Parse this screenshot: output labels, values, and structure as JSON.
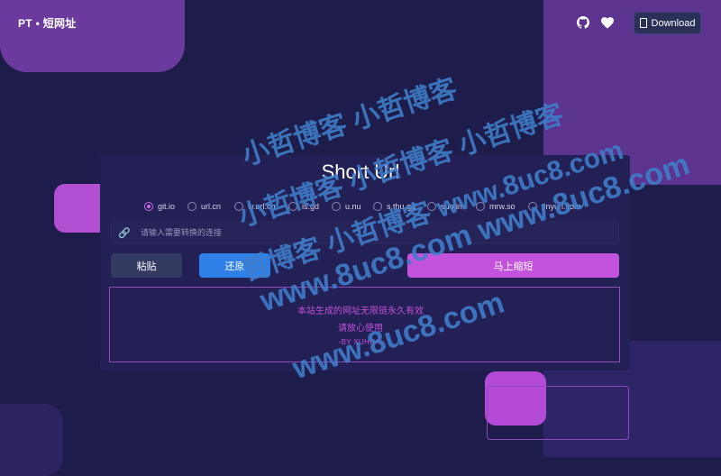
{
  "header": {
    "brand": "PT • 短网址",
    "download_label": "Download",
    "icons": {
      "github": "github-icon",
      "heart": "heart-icon"
    }
  },
  "main": {
    "title": "Short Url",
    "services": [
      {
        "label": "git.io",
        "selected": true
      },
      {
        "label": "url.cn",
        "selected": false
      },
      {
        "label": "w.url.cn",
        "selected": false
      },
      {
        "label": "is.gd",
        "selected": false
      },
      {
        "label": "u.nu",
        "selected": false
      },
      {
        "label": "s.thu.gg",
        "selected": false
      },
      {
        "label": "suo.im",
        "selected": false
      },
      {
        "label": "mrw.so",
        "selected": false
      },
      {
        "label": "tinyurl.com",
        "selected": false
      }
    ],
    "url_placeholder": "请输入需要转换的连接",
    "paste_label": "粘贴",
    "restore_label": "还原",
    "shorten_label": "马上缩短",
    "result": {
      "line1": "本站生成的网址无限链永久有效",
      "line2": "请放心使用",
      "line3": "-BY XUHUAI"
    }
  },
  "watermark": {
    "line1": "小哲博客 小哲博客",
    "line2": "小哲博客 小哲博客 小哲博客",
    "line3": "哲博客 小哲博客 www.8uc8.com",
    "line4": "www.8uc8.com www.8uc8.com",
    "line5": "www.8uc8.com"
  },
  "colors": {
    "background": "#1e1c4a",
    "card": "#232056",
    "accent_purple": "#c352dc",
    "accent_blue": "#2f7fe9"
  }
}
